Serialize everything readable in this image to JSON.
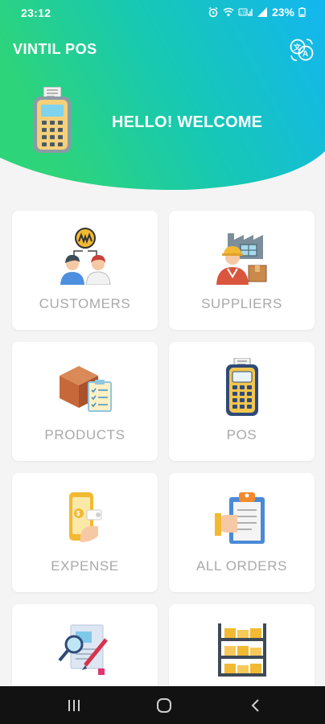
{
  "status": {
    "time": "23:12",
    "battery": "23%"
  },
  "app": {
    "title": "VINTIL POS",
    "welcome": "HELLO! WELCOME"
  },
  "menu": [
    {
      "label": "CUSTOMERS",
      "icon": "customers-icon"
    },
    {
      "label": "SUPPLIERS",
      "icon": "suppliers-icon"
    },
    {
      "label": "PRODUCTS",
      "icon": "products-icon"
    },
    {
      "label": "POS",
      "icon": "pos-terminal-icon"
    },
    {
      "label": "EXPENSE",
      "icon": "expense-icon"
    },
    {
      "label": "ALL ORDERS",
      "icon": "orders-clipboard-icon"
    },
    {
      "label": "",
      "icon": "report-icon"
    },
    {
      "label": "",
      "icon": "warehouse-shelf-icon"
    }
  ],
  "colors": {
    "gradient_start": "#2ed47a",
    "gradient_end": "#13b6f0",
    "label": "#a9a9a9",
    "navbar": "#121212"
  }
}
